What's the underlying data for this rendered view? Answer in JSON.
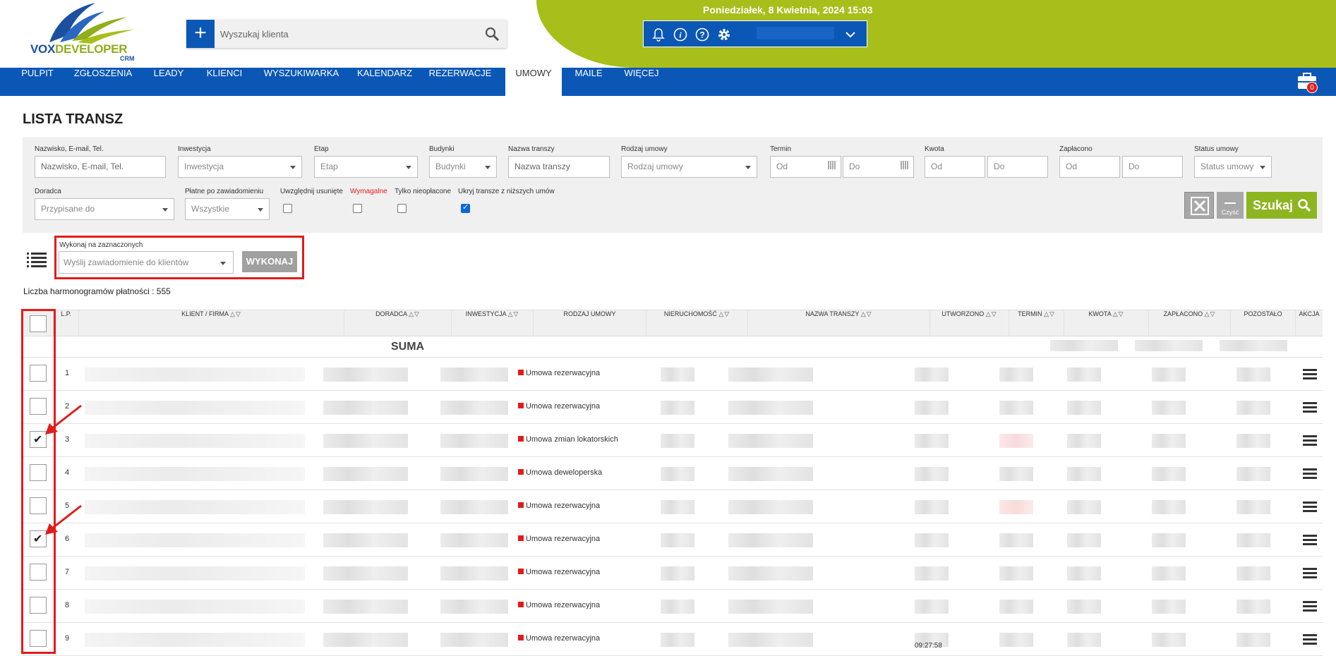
{
  "header": {
    "logo_text_a": "VOX",
    "logo_text_b": "DEVELOPER",
    "logo_crm": "CRM",
    "search_placeholder": "Wyszukaj klienta",
    "datetime": "Poniedziałek, 8 Kwietnia, 2024   15:03",
    "cart_count": "0"
  },
  "nav": {
    "items": [
      "PULPIT",
      "ZGŁOSZENIA",
      "LEADY",
      "KLIENCI",
      "WYSZUKIWARKA",
      "KALENDARZ",
      "REZERWACJE",
      "UMOWY",
      "MAILE",
      "WIĘCEJ"
    ],
    "active": "UMOWY"
  },
  "page": {
    "title": "LISTA TRANSZ"
  },
  "filters": {
    "name_label": "Nazwisko, E-mail, Tel.",
    "name_placeholder": "Nazwisko, E-mail, Tel.",
    "inwestycja_label": "Inwestycja",
    "inwestycja_value": "Inwestycja",
    "etap_label": "Etap",
    "etap_value": "Etap",
    "budynki_label": "Budynki",
    "budynki_value": "Budynki",
    "nazwa_label": "Nazwa transzy",
    "nazwa_placeholder": "Nazwa transzy",
    "rodzaj_label": "Rodzaj umowy",
    "rodzaj_value": "Rodzaj umowy",
    "termin_label": "Termin",
    "termin_od": "Od",
    "termin_do": "Do",
    "kwota_label": "Kwota",
    "kwota_od": "Od",
    "kwota_do": "Do",
    "zaplacono_label": "Zapłacono",
    "zaplacono_od": "Od",
    "zaplacono_do": "Do",
    "status_label": "Status umowy",
    "status_value": "Status umowy",
    "doradca_label": "Doradca",
    "doradca_value": "Przypisane do",
    "platne_label": "Płatne po zawiadomieniu",
    "platne_value": "Wszystkie",
    "usuniete_label": "Uwzględnij usunięte",
    "wymagalne_label": "Wymagalne",
    "nieoplacone_label": "Tylko nieopłacone",
    "ukryj_label": "Ukryj transze z niższych umów",
    "ukryj_checked": true,
    "clear_label": "Czyść",
    "search_label": "Szukaj"
  },
  "bulk": {
    "label": "Wykonaj na zaznaczonych",
    "select_value": "Wyślij zawiadomienie do klientów",
    "button": "WYKONAJ"
  },
  "count": {
    "label": "Liczba harmonogramów płatności :",
    "value": "555"
  },
  "table": {
    "columns": [
      "L.P.",
      "KLIENT / FIRMA",
      "DORADCA",
      "INWESTYCJA",
      "RODZAJ UMOWY",
      "NIERUCHOMOŚĆ",
      "NAZWA TRANSZY",
      "UTWORZONO",
      "TERMIN",
      "KWOTA",
      "ZAPŁACONO",
      "POZOSTAŁO",
      "AKCJA"
    ],
    "sum_label": "SUMA",
    "rows": [
      {
        "lp": "1",
        "type": "Umowa rezerwacyjna",
        "checked": false
      },
      {
        "lp": "2",
        "type": "Umowa rezerwacyjna",
        "checked": false
      },
      {
        "lp": "3",
        "type": "Umowa zmian lokatorskich",
        "checked": true
      },
      {
        "lp": "4",
        "type": "Umowa deweloperska",
        "checked": false
      },
      {
        "lp": "5",
        "type": "Umowa rezerwacyjna",
        "checked": false
      },
      {
        "lp": "6",
        "type": "Umowa rezerwacyjna",
        "checked": true
      },
      {
        "lp": "7",
        "type": "Umowa rezerwacyjna",
        "checked": false
      },
      {
        "lp": "8",
        "type": "Umowa rezerwacyjna",
        "checked": false
      },
      {
        "lp": "9",
        "type": "Umowa rezerwacyjna",
        "checked": false
      }
    ],
    "row9_client": "Testowy Klient",
    "row9_doradca": "Łódź, Monika",
    "row9_inwestycja": "Test SK",
    "row9_time": "09:27:58"
  },
  "colors": {
    "brand_blue": "#0b57b6",
    "brand_green": "#a8be1a",
    "alert_red": "#e21b1b"
  }
}
